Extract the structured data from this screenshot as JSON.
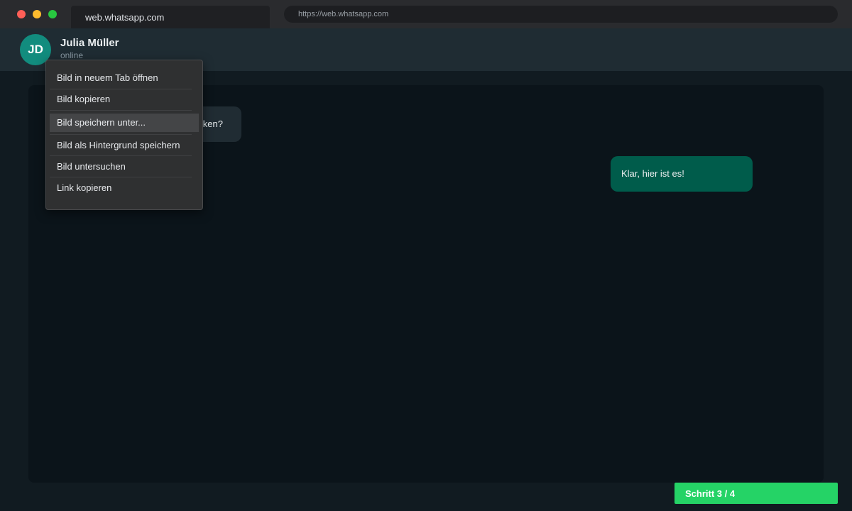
{
  "browser": {
    "tab_title": "web.whatsapp.com",
    "url": "https://web.whatsapp.com"
  },
  "chat_header": {
    "avatar_initials": "JD",
    "contact_name": "Julia Müller",
    "status": "online"
  },
  "messages": {
    "incoming_visible_fragment": "ken?",
    "outgoing": "Klar, hier ist es!"
  },
  "context_menu": {
    "items": [
      "Bild in neuem Tab öffnen",
      "Bild kopieren",
      "Bild speichern unter...",
      "Bild als Hintergrund speichern",
      "Bild untersuchen",
      "Link kopieren"
    ],
    "highlighted_item": "Bild speichern unter..."
  },
  "step_indicator": {
    "label": "Schritt 3 / 4"
  },
  "colors": {
    "accent_green": "#25d366",
    "outgoing_bubble": "#005c4b",
    "avatar": "#128c7e"
  }
}
